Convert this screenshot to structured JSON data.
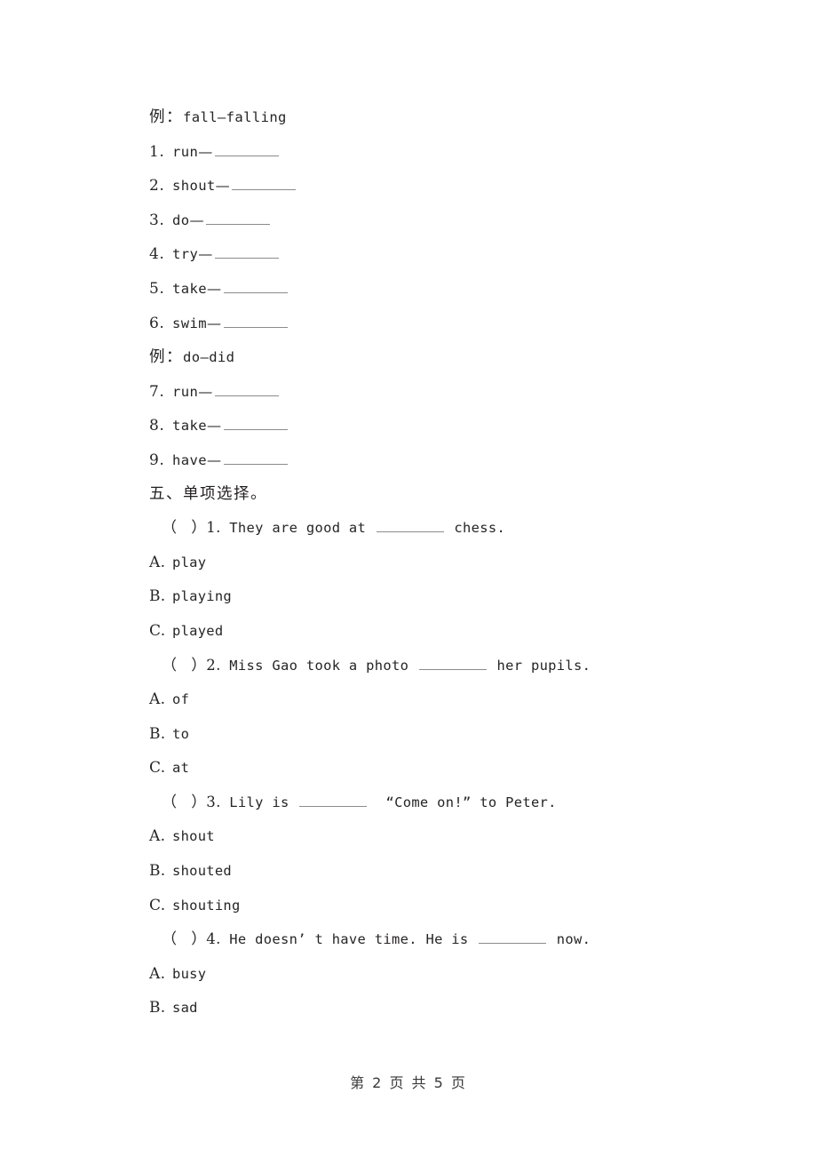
{
  "document": {
    "type": "worksheet-page",
    "language": "zh-CN + en"
  },
  "section_ing": {
    "example_label": "例：",
    "example_text": "fall—falling",
    "items": [
      {
        "num": "1.",
        "word": "run",
        "dash": "—"
      },
      {
        "num": "2.",
        "word": "shout",
        "dash": "—"
      },
      {
        "num": "3.",
        "word": "do",
        "dash": "—"
      },
      {
        "num": "4.",
        "word": "try",
        "dash": "—"
      },
      {
        "num": "5.",
        "word": "take",
        "dash": "—"
      },
      {
        "num": "6.",
        "word": "swim",
        "dash": "—"
      }
    ]
  },
  "section_past": {
    "example_label": "例：",
    "example_text": "do—did",
    "items": [
      {
        "num": "7.",
        "word": "run",
        "dash": "—"
      },
      {
        "num": "8.",
        "word": "take",
        "dash": "—"
      },
      {
        "num": "9.",
        "word": "have",
        "dash": "—"
      }
    ]
  },
  "section_choice": {
    "heading": "五、单项选择。",
    "questions": [
      {
        "bracket_open": "（",
        "bracket_close": "）",
        "num": "1.",
        "text_before": "They are good at",
        "text_after": "chess.",
        "options": [
          {
            "label": "A.",
            "text": "play"
          },
          {
            "label": "B.",
            "text": "playing"
          },
          {
            "label": "C.",
            "text": "played"
          }
        ]
      },
      {
        "bracket_open": "（",
        "bracket_close": "）",
        "num": "2.",
        "text_before": "Miss Gao took a photo",
        "text_after": "her pupils.",
        "options": [
          {
            "label": "A.",
            "text": "of"
          },
          {
            "label": "B.",
            "text": "to"
          },
          {
            "label": "C.",
            "text": "at"
          }
        ]
      },
      {
        "bracket_open": "（",
        "bracket_close": "）",
        "num": "3.",
        "text_before": "Lily is",
        "text_after": "“Come on!” to Peter.",
        "options": [
          {
            "label": "A.",
            "text": "shout"
          },
          {
            "label": "B.",
            "text": "shouted"
          },
          {
            "label": "C.",
            "text": "shouting"
          }
        ]
      },
      {
        "bracket_open": "（",
        "bracket_close": "）",
        "num": "4.",
        "text_before": "He doesn’ t have time. He is",
        "text_after": "now.",
        "options": [
          {
            "label": "A.",
            "text": "busy"
          },
          {
            "label": "B.",
            "text": "sad"
          }
        ]
      }
    ]
  },
  "footer": {
    "page_text": "第 2 页 共 5 页",
    "current_page": "2",
    "total_pages": "5"
  }
}
